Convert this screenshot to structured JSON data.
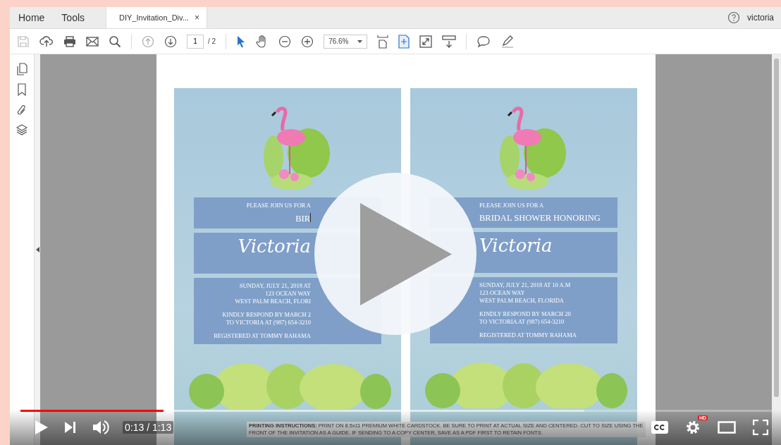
{
  "tabs": [
    {
      "label": "Home",
      "selected": false
    },
    {
      "label": "Tools",
      "selected": false
    },
    {
      "label": "DIY_Invitation_Div...",
      "selected": true,
      "close": "×"
    }
  ],
  "account": {
    "user": "victoria"
  },
  "toolbar": {
    "page": "1",
    "page_total": "/ 2",
    "zoom": "76.6%"
  },
  "cards": [
    {
      "intro": "PLEASE JOIN US FOR A",
      "event": "BIR",
      "cursor": true,
      "name": "Victoria",
      "details": [
        "SUNDAY, JULY 21, 2018 AT",
        "123 OCEAN WAY",
        "WEST PALM BEACH, FLORI"
      ],
      "rsvp": [
        "KINDLY RESPOND BY MARCH 2",
        "TO VICTORIA AT (987) 654-3210"
      ],
      "registry": "REGISTERED AT TOMMY BAHAMA"
    },
    {
      "intro": "PLEASE JOIN US FOR A",
      "event": "BRIDAL SHOWER HONORING",
      "cursor": false,
      "name": "Victoria",
      "details": [
        "SUNDAY, JULY 21, 2018 AT 10 A.M",
        "123 OCEAN WAY",
        "WEST PALM BEACH, FLORIDA"
      ],
      "rsvp": [
        "KINDLY RESPOND BY MARCH 20",
        "TO VICTORIA AT (987) 654-3210"
      ],
      "registry": "REGISTERED AT TOMMY BAHAMA"
    }
  ],
  "instructions": "**PRINTING INSTRUCTIONS:** PRINT ON 8.5x11 PREMIUM WHITE CARDSTOCK. BE SURE TO PRINT AT ACTUAL SIZE AND CENTERED. CUT TO SIZE USING THE FRONT OF THE INVITATION AS A GUIDE. IF SENDING TO A COPY CENTER, SAVE AS A PDF FIRST TO RETAIN FONTS.",
  "player": {
    "progress": {
      "level": 0.19
    },
    "time": "0:13 / 1:13",
    "hd": "HD"
  }
}
